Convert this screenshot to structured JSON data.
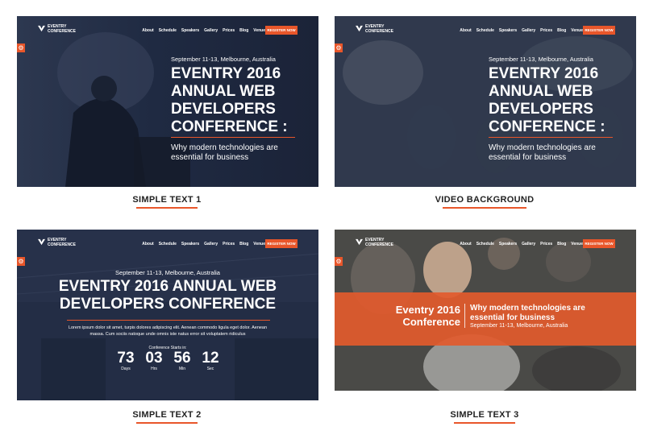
{
  "common": {
    "logo_line1": "EVENTRY",
    "logo_line2": "CONFERENCE",
    "nav": [
      "About",
      "Schedule",
      "Speakers",
      "Gallery",
      "Prices",
      "Blog",
      "Venue"
    ],
    "register": "REGISTER NOW",
    "date": "September 11-13, Melbourne, Australia",
    "subtitle_line1": "Why modern technologies are",
    "subtitle_line2": "essential for business"
  },
  "cards": {
    "simple1": {
      "caption": "SIMPLE TEXT 1",
      "title_lines": [
        "EVENTRY 2016",
        "ANNUAL WEB",
        "DEVELOPERS",
        "CONFERENCE :"
      ]
    },
    "video": {
      "caption": "VIDEO BACKGROUND",
      "title_lines": [
        "EVENTRY 2016",
        "ANNUAL WEB",
        "DEVELOPERS",
        "CONFERENCE :"
      ]
    },
    "simple2": {
      "caption": "SIMPLE TEXT 2",
      "title_lines": [
        "EVENTRY 2016 ANNUAL WEB",
        "DEVELOPERS CONFERENCE"
      ],
      "lorem_line1": "Lorem ipsum dolor sit amet, turpis dolores adipiscing elit. Aenean commodo ligula eget dolor. Aenean",
      "lorem_line2": "massa. Cum sociis natoque unde omnis iste natus error sit voluptatem ridiculus",
      "starts": "Conference Starts in:",
      "countdown": [
        {
          "value": "73",
          "label": "Days"
        },
        {
          "value": "03",
          "label": "Hrs"
        },
        {
          "value": "56",
          "label": "Min"
        },
        {
          "value": "12",
          "label": "Sec"
        }
      ]
    },
    "simple3": {
      "caption": "SIMPLE TEXT 3",
      "band_left_line1": "Eventry 2016",
      "band_left_line2": "Conference",
      "band_right_line1": "Why modern technologies are",
      "band_right_line2": "essential for business",
      "band_date": "September 11-13, Melbourne, Australia"
    }
  },
  "colors": {
    "accent": "#e8562a",
    "overlay_dark": "#1f2a44"
  }
}
